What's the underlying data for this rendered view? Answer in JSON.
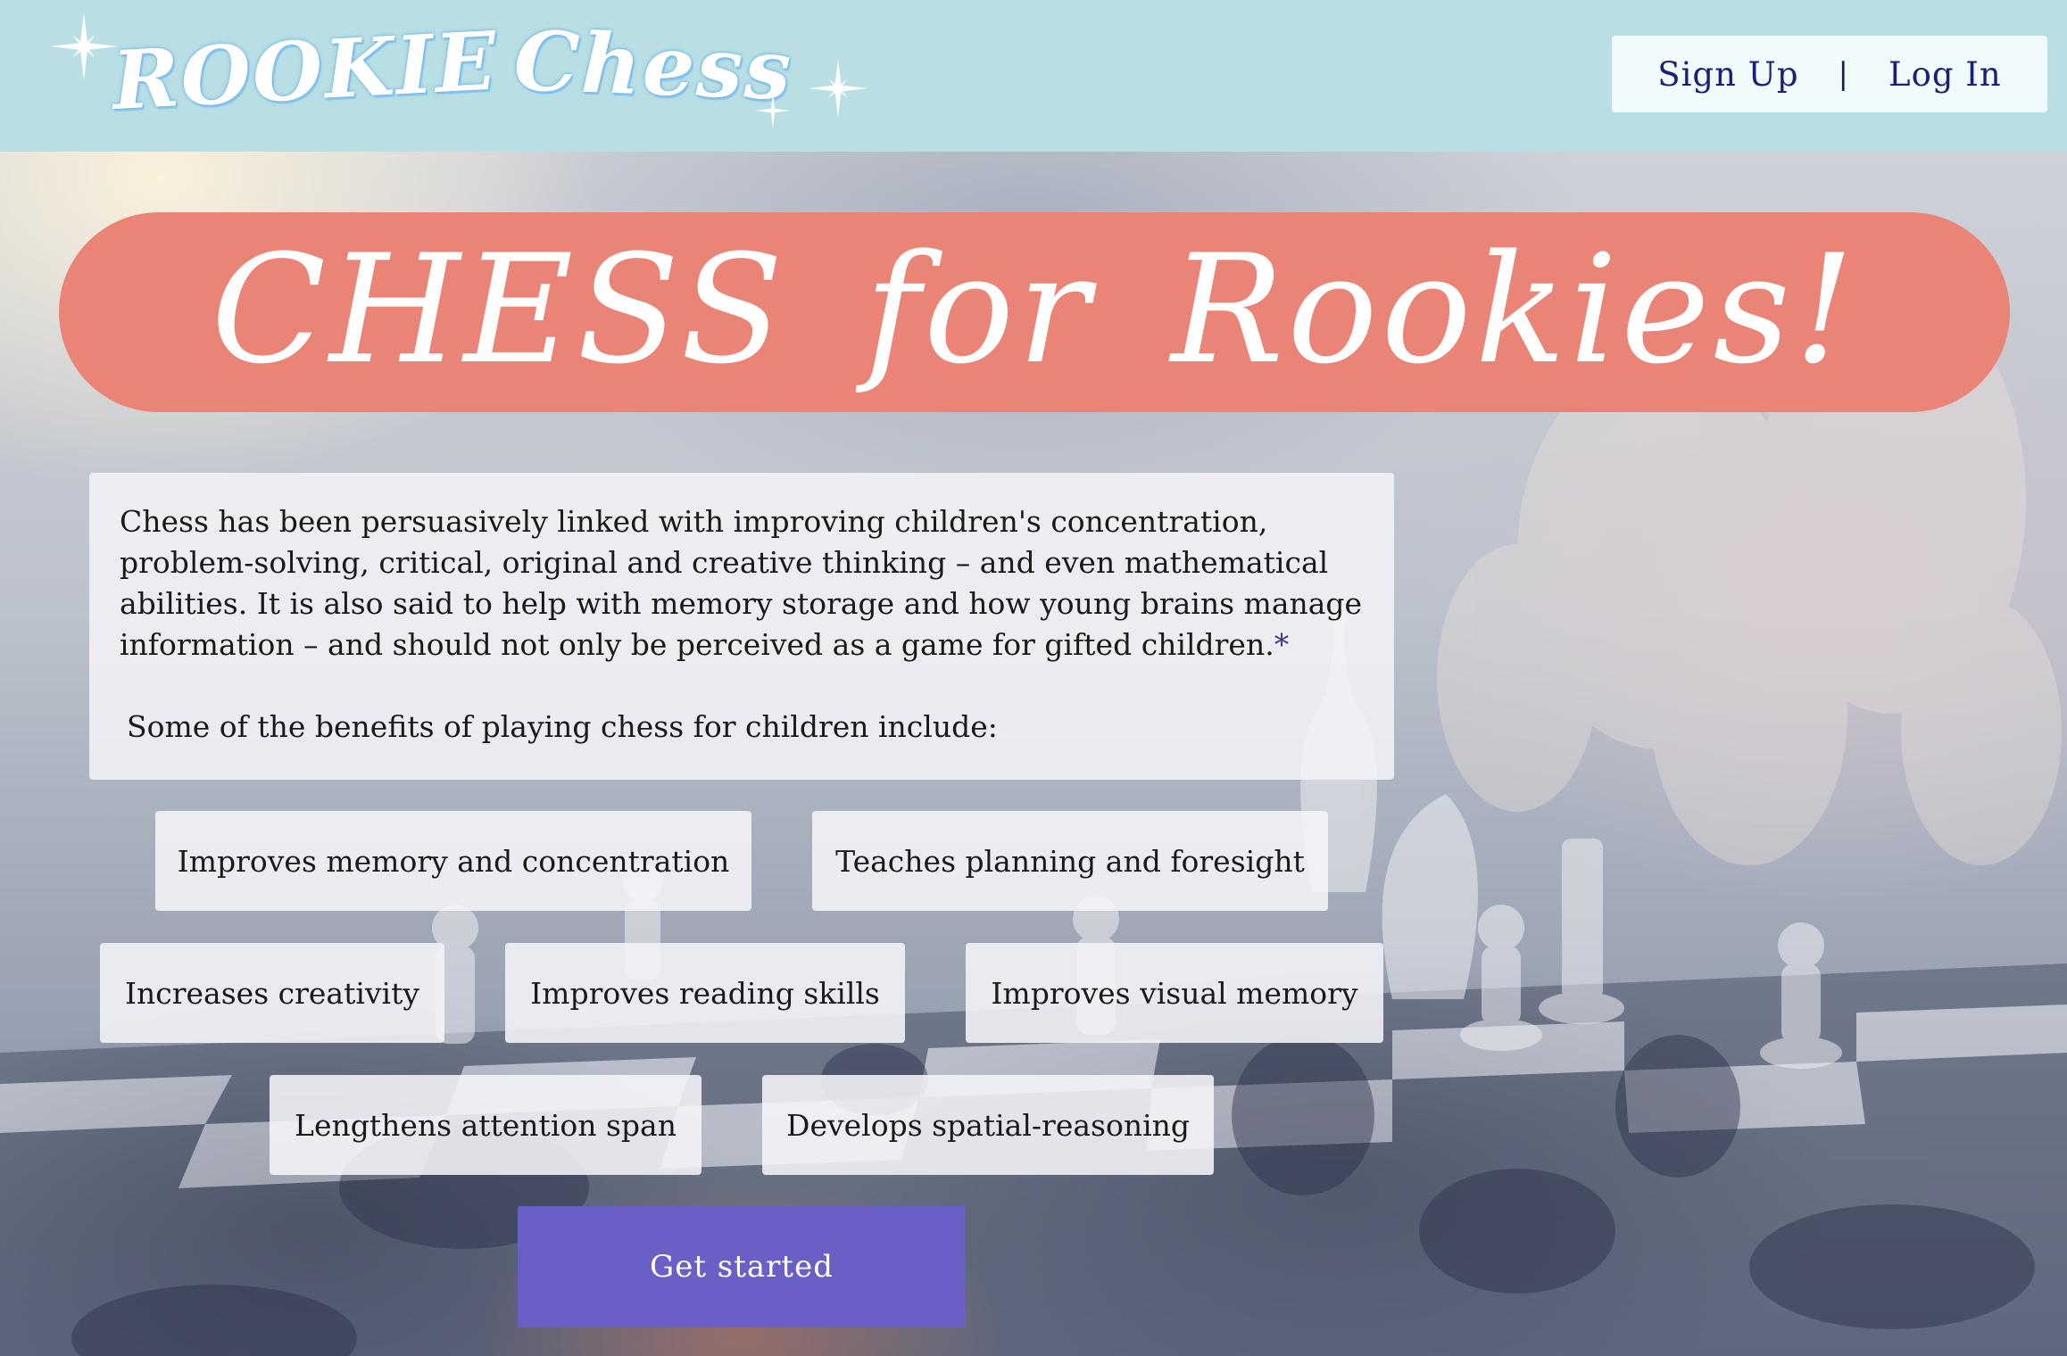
{
  "header": {
    "logo_word_1": "ROOKIE",
    "logo_word_2": "Chess",
    "sign_up_label": "Sign Up",
    "separator": "|",
    "log_in_label": "Log In"
  },
  "hero": {
    "title": "CHESS for Rookies!"
  },
  "intro": {
    "paragraph_1": "Chess has been persuasively linked with improving children's concentration, problem-solving, critical, original and creative thinking – and even mathematical abilities. It is also said to help with memory storage and how young brains manage information – and should not only be perceived as a game for gifted children.",
    "footnote_marker": "*",
    "paragraph_2": "Some of the benefits of playing chess for children include:"
  },
  "benefits": [
    "Improves memory and concentration",
    "Teaches planning and foresight",
    "Increases creativity",
    "Improves reading skills",
    "Improves visual memory",
    "Lengthens attention span",
    "Develops spatial-reasoning"
  ],
  "cta": {
    "label": "Get started"
  },
  "colors": {
    "header_bg": "#b9dfe4",
    "hero_pill": "#e98476",
    "cta_bg": "#6a5fc4",
    "auth_text": "#1a1f7a"
  }
}
